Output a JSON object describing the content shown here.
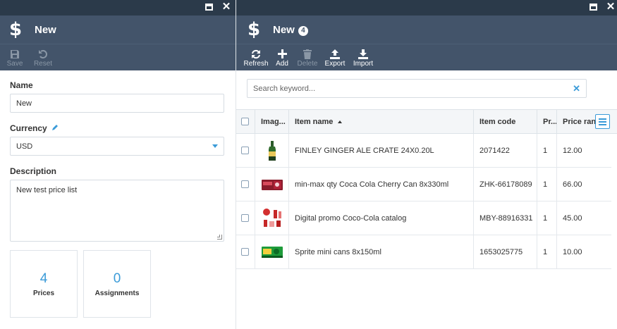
{
  "left": {
    "title": "New",
    "toolbar": {
      "save": "Save",
      "reset": "Reset"
    },
    "form": {
      "name_label": "Name",
      "name_value": "New",
      "currency_label": "Currency",
      "currency_value": "USD",
      "description_label": "Description",
      "description_value": "New test price list"
    },
    "widgets": [
      {
        "count": "4",
        "label": "Prices"
      },
      {
        "count": "0",
        "label": "Assignments"
      }
    ]
  },
  "right": {
    "title": "New",
    "badge": "4",
    "toolbar": {
      "refresh": "Refresh",
      "add": "Add",
      "delete": "Delete",
      "export": "Export",
      "import": "Import"
    },
    "search_placeholder": "Search keyword...",
    "columns": {
      "image": "Imag...",
      "name": "Item name",
      "code": "Item code",
      "pr": "Pr...",
      "price": "Price ran"
    },
    "rows": [
      {
        "name": "FINLEY GINGER ALE CRATE 24X0.20L",
        "code": "2071422",
        "pr": "1",
        "price": "12.00",
        "thumb": "bottle"
      },
      {
        "name": "min-max qty Coca Cola Cherry Can 8x330ml",
        "code": "ZHK-66178089",
        "pr": "1",
        "price": "66.00",
        "thumb": "cans-pack"
      },
      {
        "name": "Digital promo Coco-Cola catalog",
        "code": "MBY-88916331",
        "pr": "1",
        "price": "45.00",
        "thumb": "catalog"
      },
      {
        "name": "Sprite mini cans 8x150ml",
        "code": "1653025775",
        "pr": "1",
        "price": "10.00",
        "thumb": "sprite-pack"
      }
    ]
  },
  "colors": {
    "titlebar": "#2b3a4a",
    "header": "#43546a",
    "accent": "#3b9bd8"
  }
}
